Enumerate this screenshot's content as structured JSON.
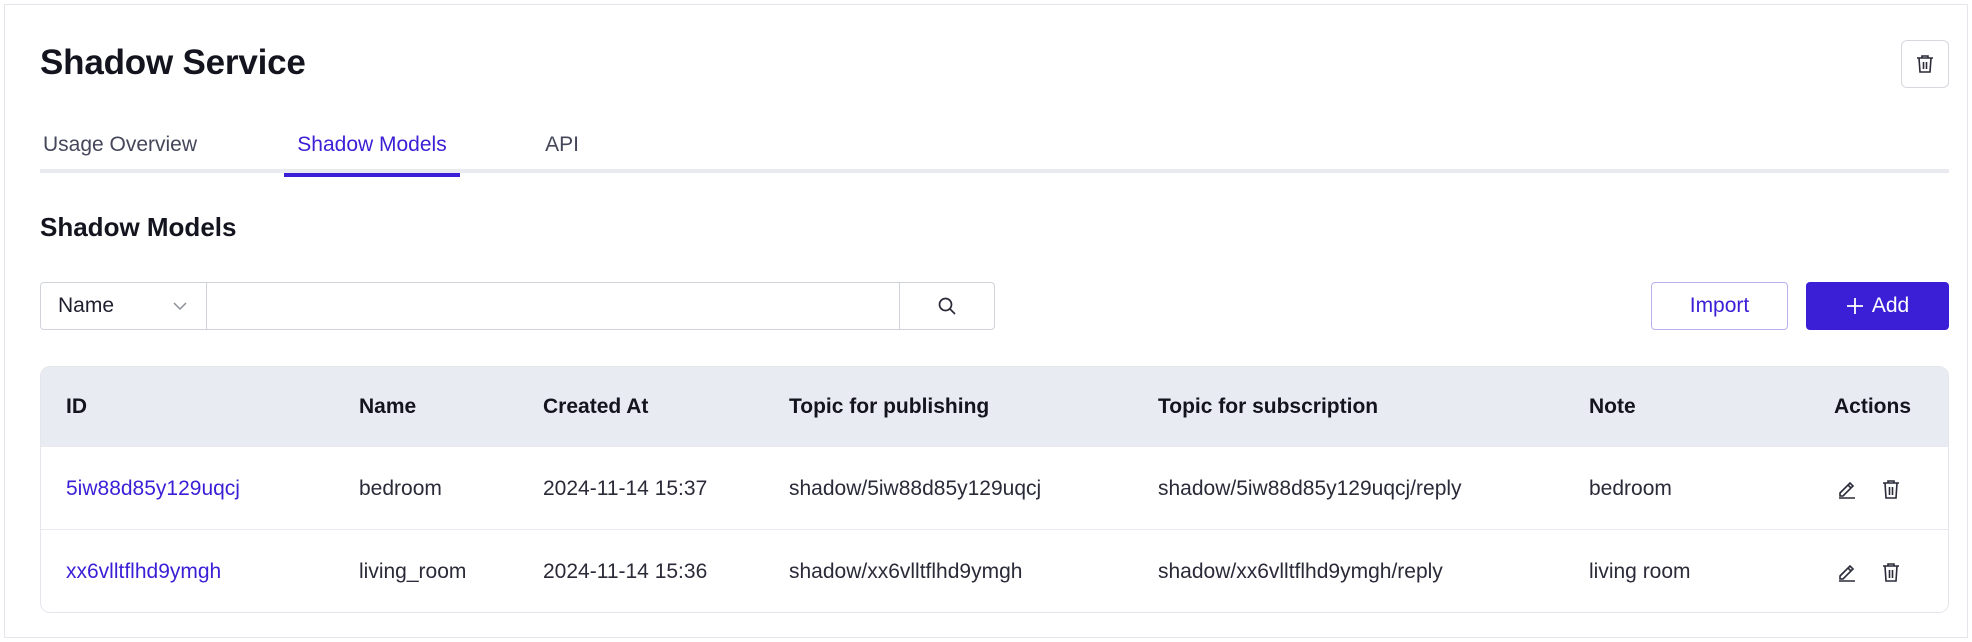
{
  "page": {
    "title": "Shadow Service"
  },
  "tabs": [
    {
      "label": "Usage Overview",
      "active": false
    },
    {
      "label": "Shadow Models",
      "active": true
    },
    {
      "label": "API",
      "active": false
    }
  ],
  "section": {
    "title": "Shadow Models"
  },
  "filter": {
    "field_label": "Name",
    "search_value": "",
    "search_placeholder": ""
  },
  "buttons": {
    "import_label": "Import",
    "add_label": "Add"
  },
  "table": {
    "columns": {
      "id": "ID",
      "name": "Name",
      "created_at": "Created At",
      "topic_publish": "Topic for publishing",
      "topic_subscribe": "Topic for subscription",
      "note": "Note",
      "actions": "Actions"
    },
    "rows": [
      {
        "id": "5iw88d85y129uqcj",
        "name": "bedroom",
        "created_at": "2024-11-14 15:37",
        "topic_publish": "shadow/5iw88d85y129uqcj",
        "topic_subscribe": "shadow/5iw88d85y129uqcj/reply",
        "note": "bedroom"
      },
      {
        "id": "xx6vlltflhd9ymgh",
        "name": "living_room",
        "created_at": "2024-11-14 15:36",
        "topic_publish": "shadow/xx6vlltflhd9ymgh",
        "topic_subscribe": "shadow/xx6vlltflhd9ymgh/reply",
        "note": "living room"
      }
    ]
  },
  "icons": {
    "top_right": "trash-icon",
    "select_caret": "chevron-down-icon",
    "search": "search-icon",
    "add": "plus-icon",
    "row_edit": "edit-icon",
    "row_delete": "trash-icon"
  },
  "colors": {
    "accent": "#3a1fd6",
    "header_bg": "#e8ebf2",
    "border": "#e4e6ec"
  }
}
